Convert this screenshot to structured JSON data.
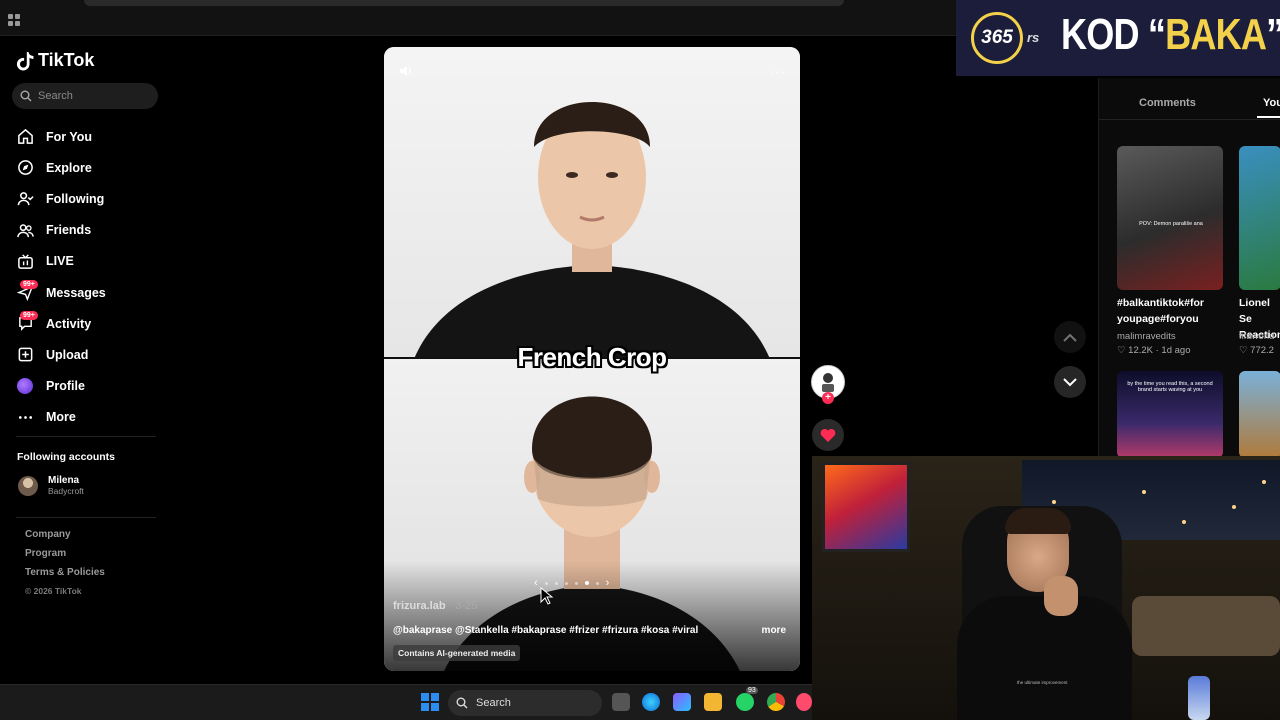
{
  "sidebar": {
    "logo": "TikTok",
    "search_placeholder": "Search",
    "nav": [
      {
        "label": "For You",
        "icon": "home-icon"
      },
      {
        "label": "Explore",
        "icon": "compass-icon"
      },
      {
        "label": "Following",
        "icon": "following-icon"
      },
      {
        "label": "Friends",
        "icon": "friends-icon"
      },
      {
        "label": "LIVE",
        "icon": "live-icon"
      },
      {
        "label": "Messages",
        "icon": "messages-icon",
        "badge": "99+"
      },
      {
        "label": "Activity",
        "icon": "activity-icon",
        "badge": "99+"
      },
      {
        "label": "Upload",
        "icon": "upload-icon"
      },
      {
        "label": "Profile",
        "icon": "profile-avatar"
      },
      {
        "label": "More",
        "icon": "more-icon"
      }
    ],
    "following_title": "Following accounts",
    "following": [
      {
        "name": "Milena",
        "handle": "Badycroft"
      }
    ],
    "footer": [
      "Company",
      "Program",
      "Terms & Policies"
    ],
    "copyright": "© 2026 TikTok"
  },
  "video": {
    "caption_overlay": "French Crop",
    "author": "frizura.lab",
    "date": "· 3-25",
    "description": "@bakaprase @Stankella #bakaprase #frizer #frizura #kosa #viral",
    "more_label": "more",
    "ai_tag": "Contains AI-generated media"
  },
  "right_panel": {
    "tabs": [
      "Comments",
      "You"
    ],
    "recs": [
      {
        "title": "#balkantiktok#for youpage#foryou",
        "author": "malimravedits",
        "stats": "♡ 12.2K · 1d ago",
        "thumb_caption": "POV: Demon parališe ana"
      },
      {
        "title": "Lionel Se Reaction",
        "author": "fifaworld",
        "stats": "♡ 772.2"
      },
      {
        "thumb_caption": "by the time you read this, a second brand starts waving at you"
      }
    ]
  },
  "brand": {
    "circle": "365",
    "suffix": "rs",
    "text_before": "KOD “",
    "text_highlight": "BAKA",
    "text_after": "”"
  },
  "webcam": {
    "shirt_text": "the ultimate improvement"
  },
  "taskbar": {
    "search_label": "Search",
    "badge": "93"
  },
  "colors": {
    "accent": "#fe2c55",
    "brand_bg": "#1c1d3a",
    "brand_yellow": "#f3d14a"
  }
}
